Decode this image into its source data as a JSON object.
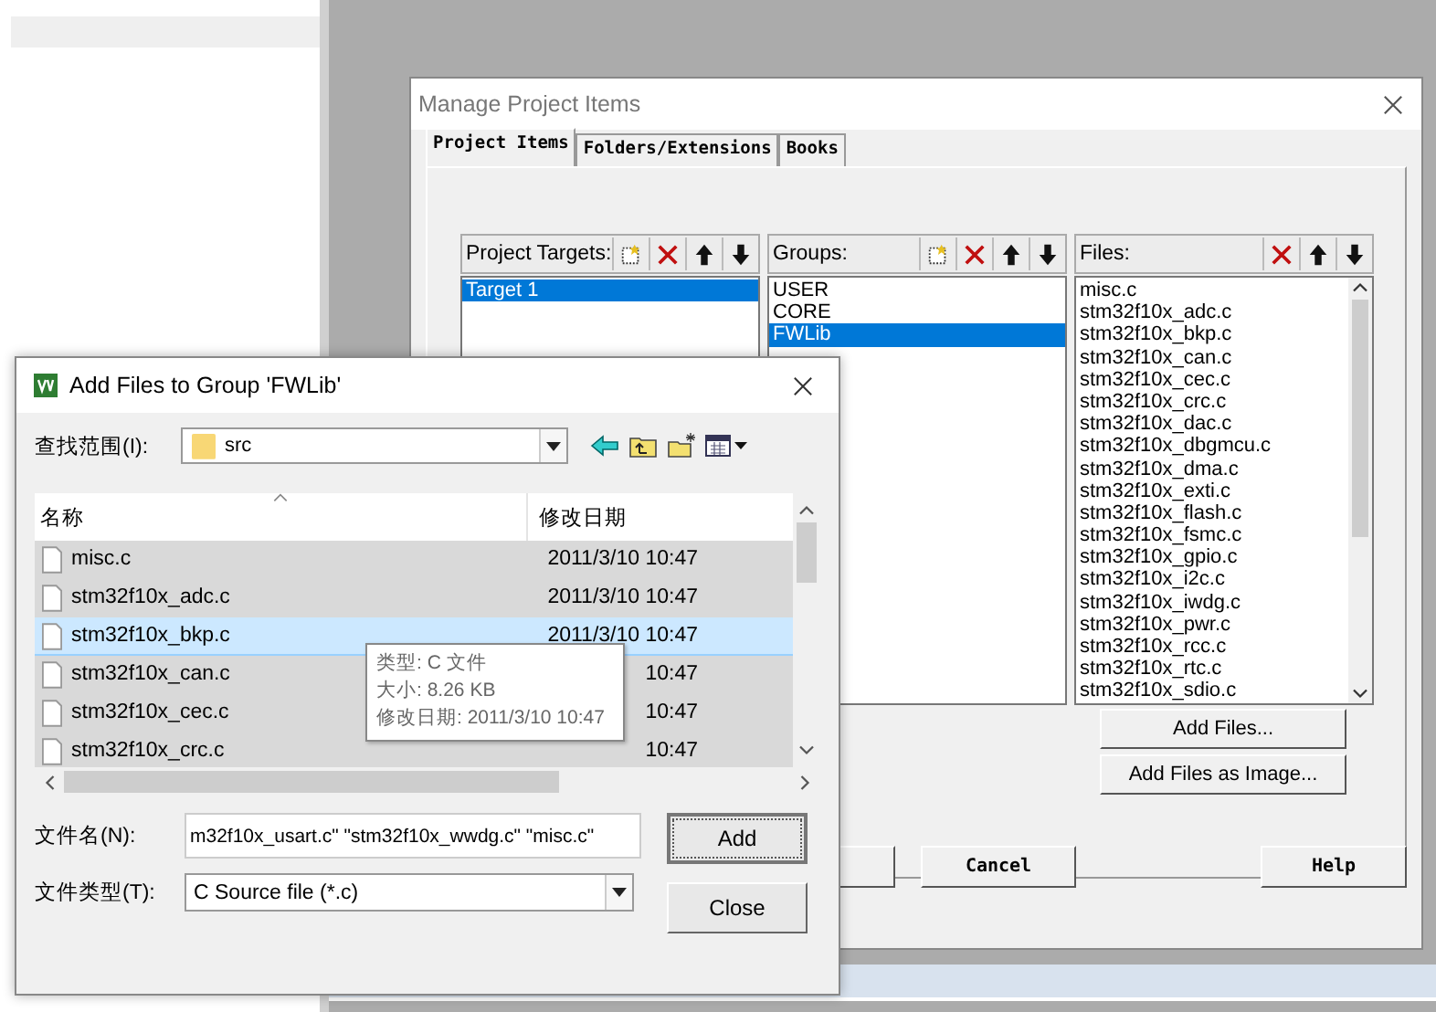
{
  "manage_window": {
    "title": "Manage Project Items",
    "tabs": [
      {
        "label": "Project Items",
        "selected": true
      },
      {
        "label": "Folders/Extensions",
        "selected": false
      },
      {
        "label": "Books",
        "selected": false
      }
    ],
    "panels": [
      {
        "label": "Project Targets:",
        "tools": [
          {
            "kind": "new"
          },
          {
            "kind": "delete"
          },
          {
            "kind": "up"
          },
          {
            "kind": "down"
          }
        ],
        "scrollbar": false,
        "items": [
          {
            "text": "Target 1",
            "selected": true
          }
        ]
      },
      {
        "label": "Groups:",
        "tools": [
          {
            "kind": "new"
          },
          {
            "kind": "delete"
          },
          {
            "kind": "up"
          },
          {
            "kind": "down"
          }
        ],
        "scrollbar": false,
        "items": [
          {
            "text": "USER",
            "selected": false
          },
          {
            "text": "CORE",
            "selected": false
          },
          {
            "text": "FWLib",
            "selected": true
          }
        ]
      },
      {
        "label": "Files:",
        "tools": [
          {
            "kind": "delete"
          },
          {
            "kind": "up"
          },
          {
            "kind": "down"
          }
        ],
        "scrollbar": true,
        "items": [
          {
            "text": "misc.c",
            "selected": false
          },
          {
            "text": "stm32f10x_adc.c",
            "selected": false
          },
          {
            "text": "stm32f10x_bkp.c",
            "selected": false
          },
          {
            "text": "stm32f10x_can.c",
            "selected": false
          },
          {
            "text": "stm32f10x_cec.c",
            "selected": false
          },
          {
            "text": "stm32f10x_crc.c",
            "selected": false
          },
          {
            "text": "stm32f10x_dac.c",
            "selected": false
          },
          {
            "text": "stm32f10x_dbgmcu.c",
            "selected": false
          },
          {
            "text": "stm32f10x_dma.c",
            "selected": false
          },
          {
            "text": "stm32f10x_exti.c",
            "selected": false
          },
          {
            "text": "stm32f10x_flash.c",
            "selected": false
          },
          {
            "text": "stm32f10x_fsmc.c",
            "selected": false
          },
          {
            "text": "stm32f10x_gpio.c",
            "selected": false
          },
          {
            "text": "stm32f10x_i2c.c",
            "selected": false
          },
          {
            "text": "stm32f10x_iwdg.c",
            "selected": false
          },
          {
            "text": "stm32f10x_pwr.c",
            "selected": false
          },
          {
            "text": "stm32f10x_rcc.c",
            "selected": false
          },
          {
            "text": "stm32f10x_rtc.c",
            "selected": false
          },
          {
            "text": "stm32f10x_sdio.c",
            "selected": false
          }
        ]
      }
    ],
    "file_buttons": [
      "Add Files...",
      "Add Files as Image..."
    ],
    "footer_buttons": [
      "Cancel",
      "Help"
    ]
  },
  "add_dialog": {
    "title": "Add Files to Group 'FWLib'",
    "look_in_label": "查找范围(I):",
    "look_in": "src",
    "columns": [
      "名称",
      "修改日期"
    ],
    "rows": [
      {
        "name": "misc.c",
        "date": "2011/3/10 10:47",
        "selected": true,
        "hovered": false
      },
      {
        "name": "stm32f10x_adc.c",
        "date": "2011/3/10 10:47",
        "selected": true,
        "hovered": false
      },
      {
        "name": "stm32f10x_bkp.c",
        "date": "2011/3/10 10:47",
        "selected": true,
        "hovered": true
      },
      {
        "name": "stm32f10x_can.c",
        "date": "10:47",
        "selected": true,
        "hovered": false
      },
      {
        "name": "stm32f10x_cec.c",
        "date": "10:47",
        "selected": true,
        "hovered": false
      },
      {
        "name": "stm32f10x_crc.c",
        "date": "10:47",
        "selected": true,
        "hovered": false
      }
    ],
    "tooltip": [
      "类型: C 文件",
      "大小: 8.26 KB",
      "修改日期: 2011/3/10 10:47"
    ],
    "file_name_label": "文件名(N):",
    "file_name": "m32f10x_usart.c\" \"stm32f10x_wwdg.c\" \"misc.c\"",
    "file_type_label": "文件类型(T):",
    "file_type": "C Source file (*.c)",
    "buttons": [
      {
        "label": "Add",
        "default": true
      },
      {
        "label": "Close",
        "default": false
      }
    ]
  }
}
